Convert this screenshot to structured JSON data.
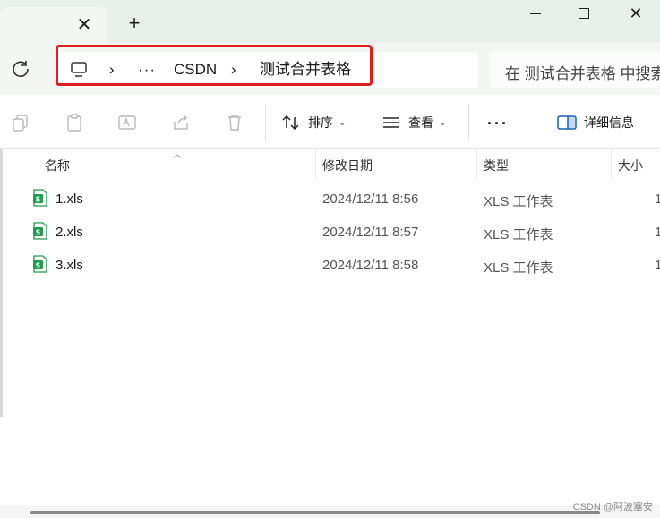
{
  "window": {
    "tab_close": "✕",
    "new_tab": "+",
    "close_glyph": "✕"
  },
  "address": {
    "sep": "›",
    "dots": "···",
    "crumb1": "CSDN",
    "crumb2": "测试合并表格",
    "search_placeholder": "在 测试合并表格 中搜索"
  },
  "toolbar": {
    "sort_label": "排序",
    "view_label": "查看",
    "more_label": "···",
    "details_label": "详细信息",
    "chevron": "⌄"
  },
  "columns": {
    "name": "名称",
    "modified": "修改日期",
    "type": "类型",
    "size": "大小"
  },
  "files": [
    {
      "name": "1.xls",
      "modified": "2024/12/11 8:56",
      "type": "XLS 工作表",
      "size": "1"
    },
    {
      "name": "2.xls",
      "modified": "2024/12/11 8:57",
      "type": "XLS 工作表",
      "size": "1"
    },
    {
      "name": "3.xls",
      "modified": "2024/12/11 8:58",
      "type": "XLS 工作表",
      "size": "1"
    }
  ],
  "watermark": "CSDN @阿波塞安",
  "colors": {
    "highlight": "#e02020",
    "xls_icon": "#1f9d4a"
  }
}
